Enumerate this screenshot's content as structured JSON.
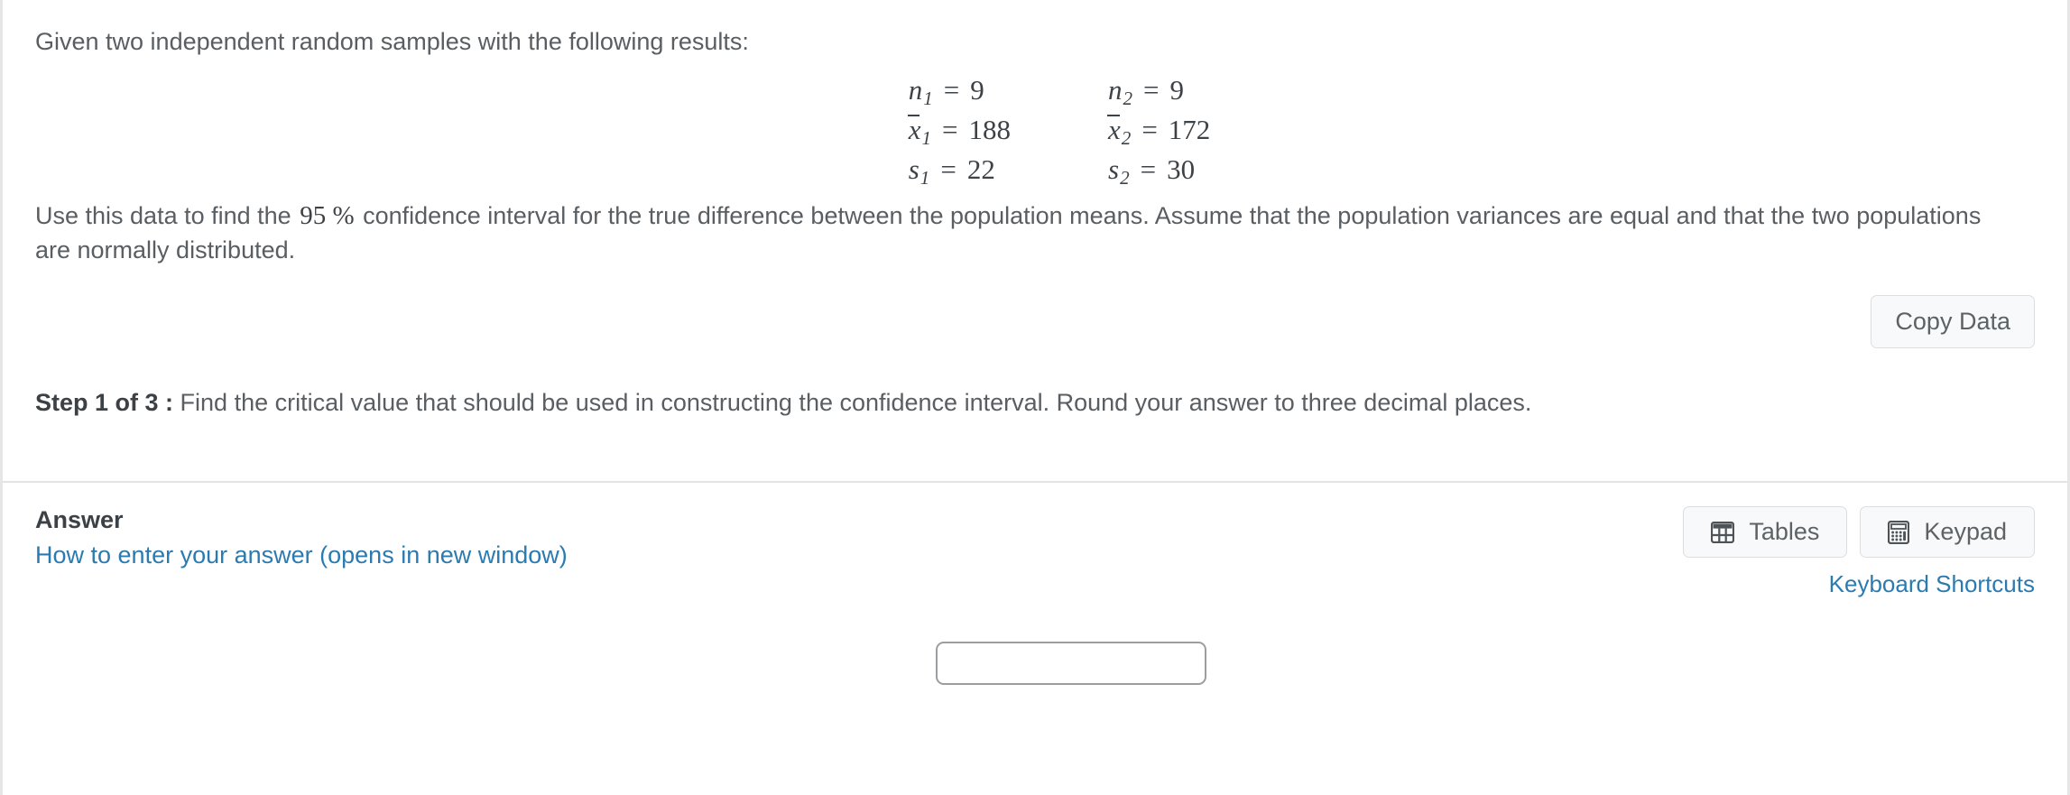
{
  "question": {
    "intro": "Given two independent random samples with the following results:",
    "math_rows": [
      {
        "left": {
          "var": "n",
          "barred": false,
          "sub": "1",
          "rel": "=",
          "value": "9"
        },
        "right": {
          "var": "n",
          "barred": false,
          "sub": "2",
          "rel": "=",
          "value": "9"
        }
      },
      {
        "left": {
          "var": "x",
          "barred": true,
          "sub": "1",
          "rel": "=",
          "value": "188"
        },
        "right": {
          "var": "x",
          "barred": true,
          "sub": "2",
          "rel": "=",
          "value": "172"
        }
      },
      {
        "left": {
          "var": "s",
          "barred": false,
          "sub": "1",
          "rel": "=",
          "value": "22"
        },
        "right": {
          "var": "s",
          "barred": false,
          "sub": "2",
          "rel": "=",
          "value": "30"
        }
      }
    ],
    "body_before": "Use this data to find the",
    "confidence_level": "95 %",
    "body_after": "confidence interval for the true difference between the population means.  Assume that the population variances are equal and that the two populations are normally distributed."
  },
  "copy_data_button": "Copy Data",
  "step": {
    "label": "Step 1 of 3 :",
    "text": "Find the critical value that should be used in constructing the confidence interval. Round your answer to three decimal places."
  },
  "answer": {
    "title": "Answer",
    "help_link": "How to enter your answer (opens in new window)",
    "tables_button": "Tables",
    "keypad_button": "Keypad",
    "shortcuts_link": "Keyboard Shortcuts",
    "input_value": "",
    "input_placeholder": ""
  },
  "colors": {
    "link": "#2b7bb0",
    "text": "#595e62",
    "heading": "#3c4145",
    "button_bg": "#f8f9fa",
    "button_border": "#dcdfe2",
    "divider": "#e4e4e4",
    "input_border": "#9a9ea1"
  }
}
